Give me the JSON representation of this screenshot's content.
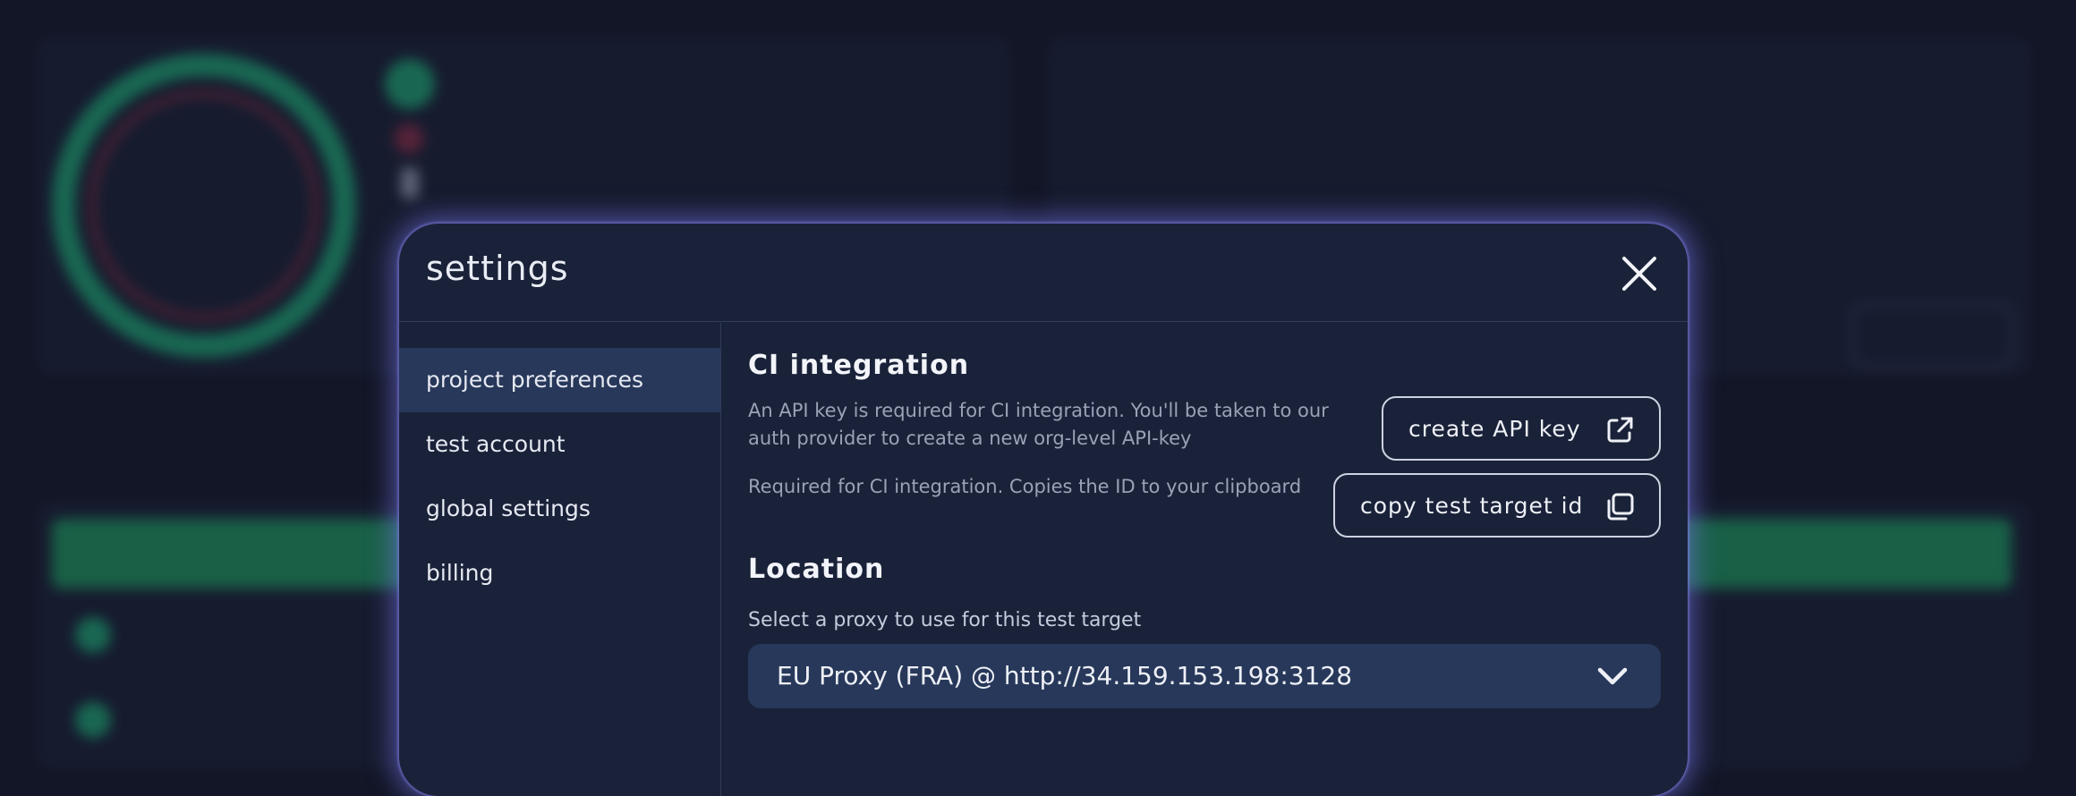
{
  "modal": {
    "title": "settings"
  },
  "sidebar": {
    "items": [
      {
        "label": "project preferences",
        "active": true
      },
      {
        "label": "test account",
        "active": false
      },
      {
        "label": "global settings",
        "active": false
      },
      {
        "label": "billing",
        "active": false
      }
    ]
  },
  "ci_integration": {
    "heading": "CI integration",
    "api_key_description": "An API key is required for CI integration. You'll be taken to our auth provider to create a new org-level API-key",
    "create_api_key_label": "create API key",
    "create_api_key_icon": "external-link-icon",
    "test_target_description": "Required for CI integration. Copies the ID to your clipboard",
    "copy_test_target_label": "copy test target id",
    "copy_test_target_icon": "copy-icon"
  },
  "location": {
    "heading": "Location",
    "label": "Select a proxy to use for this test target",
    "selected": "EU Proxy (FRA) @ http://34.159.153.198:3128"
  },
  "colors": {
    "modal_bg": "#1a2239",
    "active_item_bg": "#27385a",
    "glow": "#7876eb",
    "status_green": "#1faa78"
  }
}
